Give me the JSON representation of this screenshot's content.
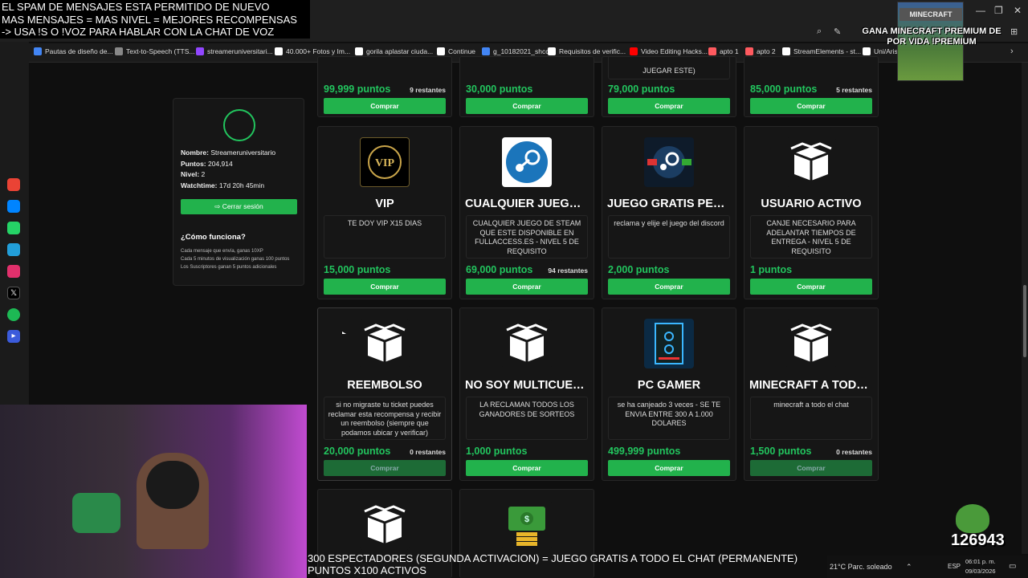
{
  "overlay_top": {
    "line1": "EL SPAM DE MENSAJES ESTA PERMITIDO DE NUEVO",
    "line2": "MAS MENSAJES = MAS NIVEL = MEJORES RECOMPENSAS",
    "line3": "-> USA !S O !VOZ PARA HABLAR CON LA CHAT DE VOZ"
  },
  "bookmarks": [
    {
      "label": "Pautas de diseño de...",
      "color": "#4285f4"
    },
    {
      "label": "Text-to-Speech (TTS...",
      "color": "#888888"
    },
    {
      "label": "streameruniversitari...",
      "color": "#9146ff"
    },
    {
      "label": "40.000+ Fotos y Im...",
      "color": "#ffffff"
    },
    {
      "label": "gorila aplastar ciuda...",
      "color": "#ffffff"
    },
    {
      "label": "Continue",
      "color": "#ffffff"
    },
    {
      "label": "g_10182021_shcc",
      "color": "#4285f4"
    },
    {
      "label": "Requisitos de verific...",
      "color": "#ffffff"
    },
    {
      "label": "Video Editing Hacks...",
      "color": "#ff0000"
    },
    {
      "label": "apto 1",
      "color": "#ff5a5f"
    },
    {
      "label": "apto 2",
      "color": "#ff5a5f"
    },
    {
      "label": "StreamElements - st...",
      "color": "#ffffff"
    },
    {
      "label": "Uni/Aris",
      "color": "#ffffff"
    }
  ],
  "profile": {
    "name_label": "Nombre:",
    "name_value": "Streameruniversitario",
    "points_label": "Puntos:",
    "points_value": "204,914",
    "level_label": "Nivel:",
    "level_value": "2",
    "watch_label": "Watchtime:",
    "watch_value": "17d 20h 45min",
    "logout_label": "Cerrar sesión",
    "how_title": "¿Cómo funciona?",
    "how_lines": [
      "Cada mensaje que envía, ganas 10XP",
      "Cada 5 minutos de visualización ganas 100 puntos",
      "Los Suscriptores ganan 5 puntos adicionales"
    ]
  },
  "row0": [
    {
      "price": "99,999 puntos",
      "remaining": "9 restantes",
      "buy": "Comprar"
    },
    {
      "price": "30,000 puntos",
      "remaining": "",
      "buy": "Comprar"
    },
    {
      "price": "79,000 puntos",
      "remaining": "",
      "buy": "Comprar",
      "desc_tail": "JUEGAR ESTE)"
    },
    {
      "price": "85,000 puntos",
      "remaining": "5 restantes",
      "buy": "Comprar"
    }
  ],
  "row1": [
    {
      "title": "VIP",
      "desc": "TE DOY VIP X15 DIAS",
      "price": "15,000 puntos",
      "remaining": "",
      "buy": "Comprar",
      "icon": "vip-icon"
    },
    {
      "title": "CUALQUIER JUEGO D...",
      "desc": "CUALQUIER JUEGO DE STEAM QUE ESTE DISPONIBLE EN FULLACCESS.ES - NIVEL 5 DE REQUISITO",
      "price": "69,000 puntos",
      "remaining": "94 restantes",
      "buy": "Comprar",
      "icon": "steam-icon"
    },
    {
      "title": "JUEGO GRATIS PER...",
      "desc": "reclama y elije el juego del discord",
      "price": "2,000 puntos",
      "remaining": "",
      "buy": "Comprar",
      "icon": "steam-gift-icon"
    },
    {
      "title": "USUARIO ACTIVO",
      "desc": "CANJE NECESARIO PARA ADELANTAR TIEMPOS DE ENTREGA - NIVEL 5 DE REQUISITO",
      "price": "1 puntos",
      "remaining": "",
      "buy": "Comprar",
      "icon": "box-icon"
    }
  ],
  "row2": [
    {
      "title": "REEMBOLSO",
      "desc": "si no migraste tu ticket puedes reclamar esta recompensa y recibir un reembolso (siempre que podamos ubicar y verificar)",
      "price": "20,000 puntos",
      "remaining": "0 restantes",
      "buy": "Comprar",
      "icon": "box-icon"
    },
    {
      "title": "NO SOY MULTICUEN...",
      "desc": "LA RECLAMAN TODOS LOS GANADORES DE SORTEOS",
      "price": "1,000 puntos",
      "remaining": "",
      "buy": "Comprar",
      "icon": "box-icon"
    },
    {
      "title": "PC GAMER",
      "desc": "se ha canjeado 3 veces - SE TE ENVIA ENTRE 300 A 1.000 DOLARES",
      "price": "499,999 puntos",
      "remaining": "",
      "buy": "Comprar",
      "icon": "pc-icon"
    },
    {
      "title": "MINECRAFT A TODO ...",
      "desc": "minecraft a todo el chat",
      "price": "1,500 puntos",
      "remaining": "0 restantes",
      "buy": "Comprar",
      "icon": "box-icon"
    }
  ],
  "overlay_minecraft": {
    "logo": "MINECRAFT",
    "text": "GANA MINECRAFT PREMIUM DE POR VIDA !PREMIUM"
  },
  "counter": "126943",
  "overlay_bottom": {
    "line1": "300 ESPECTADORES (SEGUNDA ACTIVACION) = JUEGO GRATIS A TODO EL CHAT (PERMANENTE)",
    "line2": "PUNTOS X100 ACTIVOS"
  },
  "taskbar": {
    "weather": "21°C  Parc. soleado",
    "lang": "ESP",
    "time": "06:01 p. m.",
    "date": "09/03/2026"
  }
}
